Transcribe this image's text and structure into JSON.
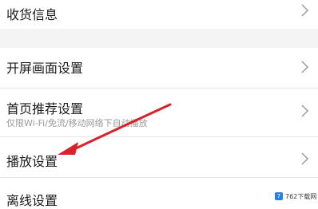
{
  "settings": {
    "rows": [
      {
        "label": "收货信息"
      },
      {
        "label": "开屏画面设置"
      },
      {
        "label": "首页推荐设置",
        "sub": "仅限Wi-Fi/免流/移动网络下自动播放"
      },
      {
        "label": "播放设置"
      },
      {
        "label": "离线设置"
      }
    ]
  },
  "annotation": {
    "arrow_color": "#d8232a"
  },
  "watermark": {
    "logo": "7",
    "text": "762下载网"
  }
}
